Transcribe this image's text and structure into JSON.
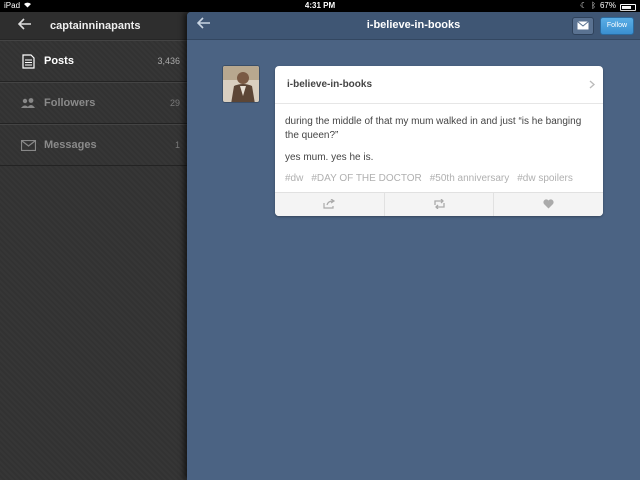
{
  "statusbar": {
    "device": "iPad",
    "time": "4:31 PM",
    "battery": "67%"
  },
  "sidebar": {
    "title": "captainninapants",
    "items": [
      {
        "label": "Posts",
        "count": "3,436",
        "icon": "document-icon"
      },
      {
        "label": "Followers",
        "count": "29",
        "icon": "people-icon"
      },
      {
        "label": "Messages",
        "count": "1",
        "icon": "mail-icon"
      }
    ]
  },
  "main": {
    "title": "i-believe-in-books",
    "follow_label": "Follow"
  },
  "post": {
    "blog": "i-believe-in-books",
    "paragraphs": [
      "during the middle of that my mum walked in and just “is he banging the queen?”",
      "yes mum. yes he is."
    ],
    "tags": [
      "#dw",
      "#DAY OF THE DOCTOR",
      "#50th anniversary",
      "#dw spoilers"
    ]
  },
  "colors": {
    "sidebar_bg": "#333333",
    "main_bg": "#4b6383",
    "follow_button": "#3a8fd0"
  }
}
